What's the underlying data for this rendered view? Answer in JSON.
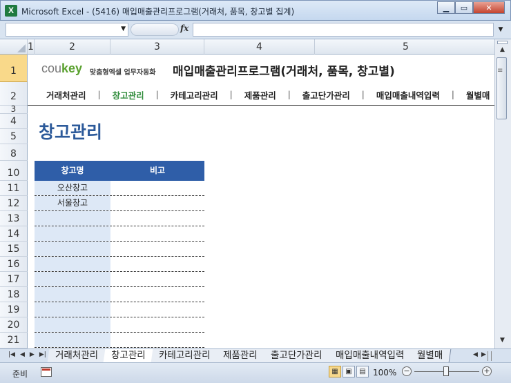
{
  "window": {
    "title": "Microsoft Excel - (5416) 매입매출관리프로그램(거래처, 품목, 창고별 집계)",
    "app_icon": "X",
    "minimize": "▁",
    "restore": "▭",
    "close": "✕"
  },
  "formula_bar": {
    "name_box": "",
    "fx_label": "fx",
    "formula": ""
  },
  "columns": [
    "1",
    "2",
    "3",
    "4",
    "5"
  ],
  "rows": [
    "1",
    "2",
    "3",
    "4",
    "5",
    "8",
    "10",
    "11",
    "12",
    "13",
    "14",
    "15",
    "16",
    "17",
    "18",
    "19",
    "20",
    "21"
  ],
  "banner": {
    "logo_main": "cou",
    "logo_key": "key",
    "tagline": "맞춤형엑셀 업무자동화",
    "title": "매입매출관리프로그램(거래처, 품목, 창고별)"
  },
  "nav": {
    "items": [
      "거래처관리",
      "창고관리",
      "카테고리관리",
      "제품관리",
      "출고단가관리",
      "매입매출내역입력",
      "월별매"
    ],
    "active_index": 1,
    "separator": "|"
  },
  "page_heading": "창고관리",
  "warehouse_table": {
    "headers": [
      "창고명",
      "비고"
    ],
    "rows": [
      [
        "오산창고",
        ""
      ],
      [
        "서울창고",
        ""
      ],
      [
        "",
        ""
      ],
      [
        "",
        ""
      ],
      [
        "",
        ""
      ],
      [
        "",
        ""
      ],
      [
        "",
        ""
      ],
      [
        "",
        ""
      ],
      [
        "",
        ""
      ],
      [
        "",
        ""
      ],
      [
        "",
        ""
      ]
    ]
  },
  "sheet_tabs": {
    "tabs": [
      "거래처관리",
      "창고관리",
      "카테고리관리",
      "제품관리",
      "출고단가관리",
      "매입매출내역입력",
      "월별매"
    ],
    "active_index": 1
  },
  "status_bar": {
    "mode": "준비",
    "zoom": "100%"
  },
  "colors": {
    "accent_blue": "#2f5ea8",
    "heading_blue": "#2c5a9a",
    "active_nav_green": "#2e8b3a",
    "logo_green": "#5aa12f"
  }
}
